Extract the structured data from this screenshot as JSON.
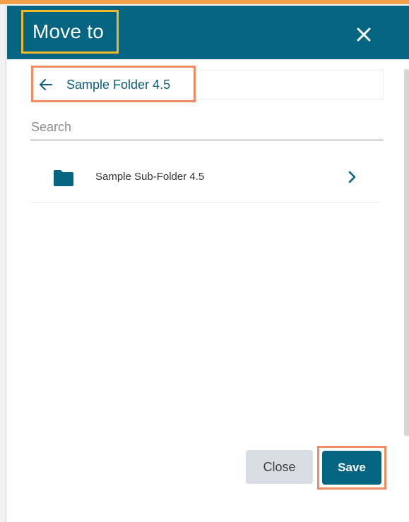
{
  "dialog": {
    "title": "Move to",
    "close_icon": "close-icon"
  },
  "breadcrumb": {
    "back_icon": "arrow-left-icon",
    "current_folder": "Sample Folder 4.5"
  },
  "search": {
    "placeholder": "Search",
    "value": ""
  },
  "folders": [
    {
      "icon": "folder-icon",
      "label": "Sample Sub-Folder 4.5",
      "chevron_icon": "chevron-right-icon"
    }
  ],
  "footer": {
    "close_label": "Close",
    "save_label": "Save"
  },
  "colors": {
    "header_bg": "#036581",
    "title_highlight": "#f5b826",
    "callout_highlight": "#ee8d63",
    "link_text": "#0b5e7d",
    "close_button_bg": "#d9dee4",
    "save_button_bg": "#036581",
    "top_accent": "#f0a14a"
  }
}
